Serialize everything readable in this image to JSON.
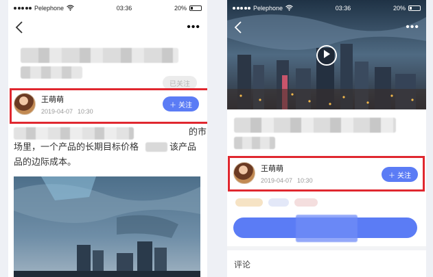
{
  "status": {
    "carrier": "Pelephone",
    "time": "03:36",
    "battery": "20%"
  },
  "left": {
    "followed_label": "已关注",
    "author": {
      "name": "王萌萌",
      "date": "2019-04-07",
      "time": "10:30"
    },
    "follow_label": "关注",
    "text_lines": [
      "的市",
      "场里，一个产品的长期目标价格",
      "该产品",
      "品的边际成本。"
    ]
  },
  "right": {
    "author": {
      "name": "王萌萌",
      "date": "2019-04-07",
      "time": "10:30"
    },
    "follow_label": "关注",
    "comments_label": "评论"
  },
  "icons": [
    "back-icon",
    "more-icon",
    "wifi-icon",
    "play-icon",
    "plus-icon"
  ],
  "colors": {
    "accent": "#5b7cf5",
    "highlight": "#e0272f",
    "followed_bg": "#ececec"
  }
}
